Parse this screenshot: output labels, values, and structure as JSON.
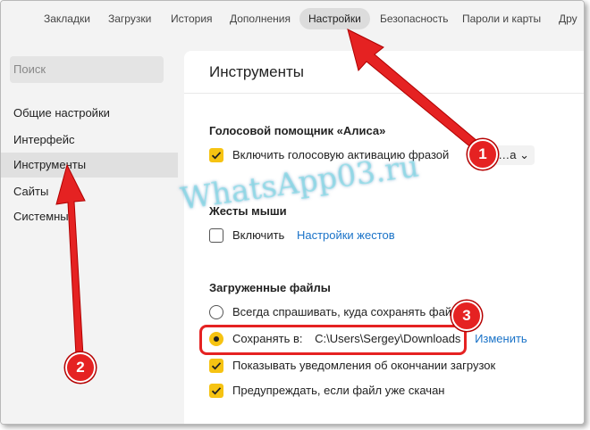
{
  "tabs": [
    "Закладки",
    "Загрузки",
    "История",
    "Дополнения",
    "Настройки",
    "Безопасность",
    "Пароли и карты",
    "Дру"
  ],
  "active_tab_index": 4,
  "sidebar": {
    "search_placeholder": "Поиск",
    "items": [
      "Общие настройки",
      "Интерфейс",
      "Инструменты",
      "Сайты",
      "Системные"
    ],
    "active_index": 2
  },
  "main": {
    "title": "Инструменты",
    "alice": {
      "section_title": "Голосовой помощник «Алиса»",
      "voice_activation_label": "Включить голосовую активацию фразой",
      "voice_activation_checked": true,
      "phrase_value": "…а"
    },
    "gestures": {
      "section_title": "Жесты мыши",
      "enable_label": "Включить",
      "enable_checked": false,
      "settings_link": "Настройки жестов"
    },
    "downloads": {
      "section_title": "Загруженные файлы",
      "always_ask_label": "Всегда спрашивать, куда сохранять файл",
      "save_to_label": "Сохранять в:",
      "save_path": "C:\\Users\\Sergey\\Downloads",
      "change_link": "Изменить",
      "notify_label": "Показывать уведомления об окончании загрузок",
      "notify_checked": true,
      "warn_label": "Предупреждать, если файл уже скачан",
      "warn_checked": true
    }
  },
  "watermark": "WhatsApp03.ru",
  "badges": [
    "1",
    "2",
    "3"
  ],
  "colors": {
    "accent_yellow": "#f6c312",
    "annotation_red": "#e52222",
    "link_blue": "#1a73c8"
  }
}
